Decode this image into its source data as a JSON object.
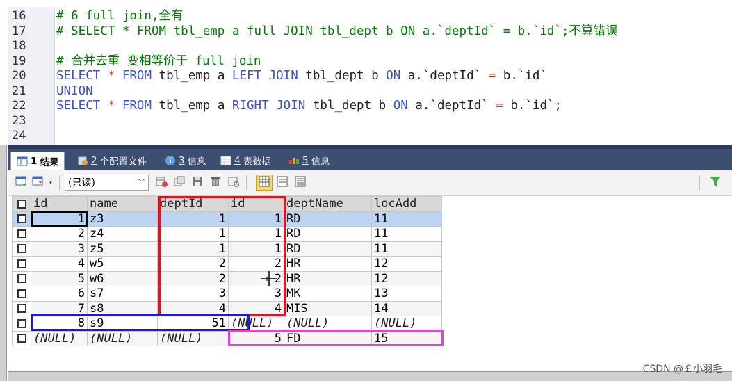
{
  "editor": {
    "lines": [
      {
        "no": "16",
        "segments": [
          {
            "t": "# 6 full join,全有",
            "c": "cm"
          }
        ]
      },
      {
        "no": "17",
        "segments": [
          {
            "t": "# SELECT * FROM tbl_emp a full JOIN tbl_dept b ON a.`deptId` = b.`id`;不算错误",
            "c": "cm"
          }
        ]
      },
      {
        "no": "18",
        "segments": []
      },
      {
        "no": "19",
        "segments": [
          {
            "t": "# 合并去重 变相等价于 full join",
            "c": "cm"
          }
        ]
      },
      {
        "no": "20",
        "segments": [
          {
            "t": "SELECT",
            "c": "kw"
          },
          {
            "t": " ",
            "c": "tx"
          },
          {
            "t": "*",
            "c": "op"
          },
          {
            "t": " ",
            "c": "tx"
          },
          {
            "t": "FROM",
            "c": "kw"
          },
          {
            "t": " tbl_emp a ",
            "c": "tx"
          },
          {
            "t": "LEFT JOIN",
            "c": "kw"
          },
          {
            "t": " tbl_dept b ",
            "c": "tx"
          },
          {
            "t": "ON",
            "c": "kw"
          },
          {
            "t": " a.`deptId` ",
            "c": "tx"
          },
          {
            "t": "=",
            "c": "op"
          },
          {
            "t": " b.`id`",
            "c": "tx"
          }
        ]
      },
      {
        "no": "21",
        "segments": [
          {
            "t": "UNION",
            "c": "kw"
          }
        ]
      },
      {
        "no": "22",
        "segments": [
          {
            "t": "SELECT",
            "c": "kw"
          },
          {
            "t": " ",
            "c": "tx"
          },
          {
            "t": "*",
            "c": "op"
          },
          {
            "t": " ",
            "c": "tx"
          },
          {
            "t": "FROM",
            "c": "kw"
          },
          {
            "t": " tbl_emp a ",
            "c": "tx"
          },
          {
            "t": "RIGHT JOIN",
            "c": "kw"
          },
          {
            "t": " tbl_dept b ",
            "c": "tx"
          },
          {
            "t": "ON",
            "c": "kw"
          },
          {
            "t": " a.`deptId` ",
            "c": "tx"
          },
          {
            "t": "=",
            "c": "op"
          },
          {
            "t": " b.`id`;",
            "c": "tx"
          }
        ]
      },
      {
        "no": "23",
        "segments": []
      },
      {
        "no": "24",
        "segments": []
      }
    ]
  },
  "tabs": [
    {
      "num": "1",
      "label": "结果",
      "icon": "result-grid-icon",
      "active": true
    },
    {
      "num": "2",
      "label": "个配置文件",
      "icon": "profile-icon",
      "active": false
    },
    {
      "num": "3",
      "label": "信息",
      "icon": "info-icon",
      "active": false
    },
    {
      "num": "4",
      "label": "表数据",
      "icon": "table-data-icon",
      "active": false
    },
    {
      "num": "5",
      "label": "信息",
      "icon": "info-icon-2",
      "active": false
    }
  ],
  "toolbar": {
    "readonly_select": "(只读)"
  },
  "grid": {
    "columns": [
      "id",
      "name",
      "deptId",
      "id",
      "deptName",
      "locAdd"
    ],
    "rows": [
      [
        "1",
        "z3",
        "1",
        "1",
        "RD",
        "11"
      ],
      [
        "2",
        "z4",
        "1",
        "1",
        "RD",
        "11"
      ],
      [
        "3",
        "z5",
        "1",
        "1",
        "RD",
        "11"
      ],
      [
        "4",
        "w5",
        "2",
        "2",
        "HR",
        "12"
      ],
      [
        "5",
        "w6",
        "2",
        "2",
        "HR",
        "12"
      ],
      [
        "6",
        "s7",
        "3",
        "3",
        "MK",
        "13"
      ],
      [
        "7",
        "s8",
        "4",
        "4",
        "MIS",
        "14"
      ],
      [
        "8",
        "s9",
        "51",
        "(NULL)",
        "(NULL)",
        "(NULL)"
      ],
      [
        "(NULL)",
        "(NULL)",
        "(NULL)",
        "5",
        "FD",
        "15"
      ]
    ],
    "highlight_colors": {
      "red": "#e0141e",
      "blue": "#1a1adc",
      "magenta": "#e83ee0"
    }
  },
  "watermark": "CSDN @￡小羽毛"
}
